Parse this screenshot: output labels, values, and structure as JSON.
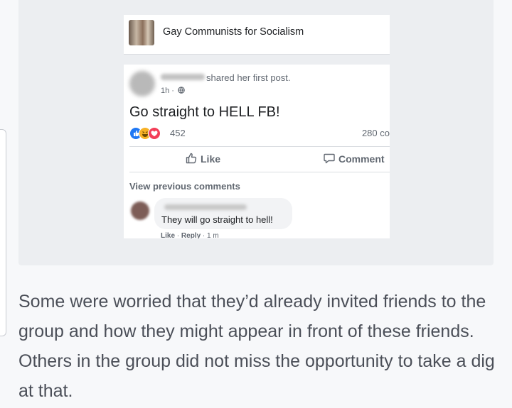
{
  "group": {
    "name": "Gay Communists for Socialism"
  },
  "post": {
    "shared_text": "shared her first post.",
    "time": "1h ·",
    "text": "Go straight to HELL FB!",
    "reaction_count": "452",
    "comments_count": "280 co",
    "like_label": "Like",
    "comment_label": "Comment"
  },
  "comments": {
    "view_previous": "View previous comments",
    "first": {
      "text": "They will go straight to hell!",
      "actions": {
        "like": "Like",
        "separator": " · ",
        "reply": "Reply",
        "time": " · 1 m"
      }
    }
  },
  "article": {
    "paragraph": "Some were worried that they’d already invited friends to the group and how they might appear in front of these friends. Others in the group did not miss the opportunity to take a dig at that."
  },
  "colors": {
    "like_reaction": "#2078f4",
    "haha_reaction": "#f7b125",
    "love_reaction": "#f33e58",
    "text_muted": "#606770"
  },
  "icons": [
    "globe-icon",
    "thumbs-up-icon",
    "comment-icon",
    "like-reaction-icon",
    "haha-reaction-icon",
    "love-reaction-icon"
  ]
}
